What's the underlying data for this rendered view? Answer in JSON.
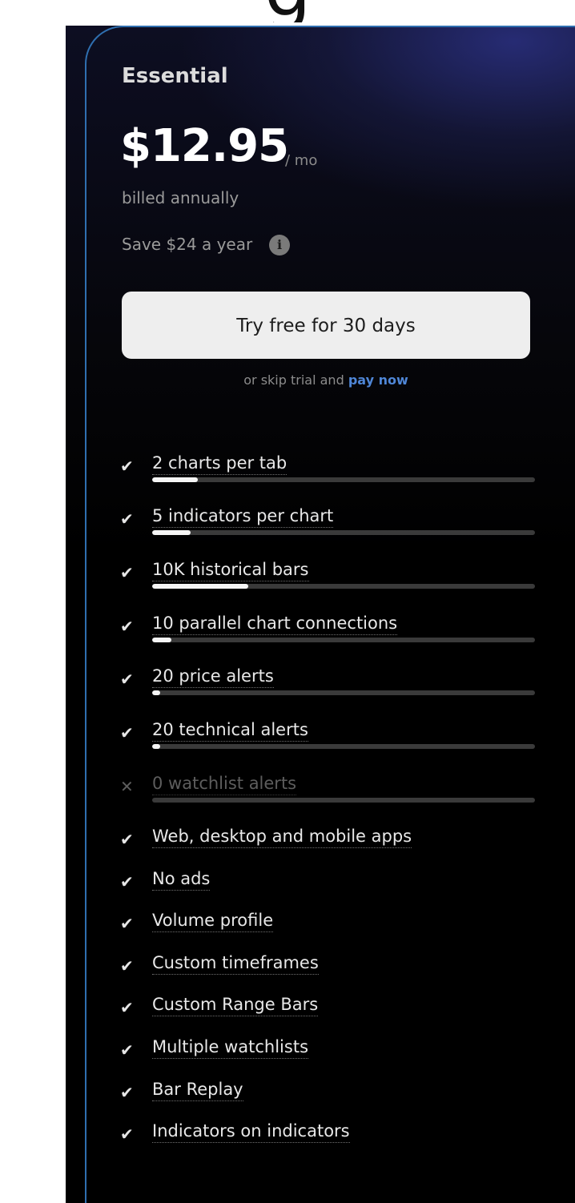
{
  "header_fragment": "g",
  "plan": {
    "name": "Essential",
    "price": "$12.95",
    "period": "/ mo",
    "billing": "billed annually",
    "savings": "Save $24 a year",
    "info_icon": "info-icon",
    "cta_label": "Try free for 30 days",
    "skip_text": "or skip trial and",
    "skip_link": "pay now"
  },
  "colors": {
    "accent_link": "#4f86d6",
    "card_border": "#2f6fb0",
    "bar_fill": "#f5f5f5",
    "bar_track": "#3a3a3a"
  },
  "features": [
    {
      "label": "2 charts per tab",
      "included": true,
      "level": 0.12
    },
    {
      "label": "5 indicators per chart",
      "included": true,
      "level": 0.1
    },
    {
      "label": "10K historical bars",
      "included": true,
      "level": 0.25
    },
    {
      "label": "10 parallel chart connections",
      "included": true,
      "level": 0.05
    },
    {
      "label": "20 price alerts",
      "included": true,
      "level": 0.02
    },
    {
      "label": "20 technical alerts",
      "included": true,
      "level": 0.02
    },
    {
      "label": "0 watchlist alerts",
      "included": false,
      "level": 0
    },
    {
      "label": "Web, desktop and mobile apps",
      "included": true
    },
    {
      "label": "No ads",
      "included": true
    },
    {
      "label": "Volume profile",
      "included": true
    },
    {
      "label": "Custom timeframes",
      "included": true
    },
    {
      "label": "Custom Range Bars",
      "included": true
    },
    {
      "label": "Multiple watchlists",
      "included": true
    },
    {
      "label": "Bar Replay",
      "included": true
    },
    {
      "label": "Indicators on indicators",
      "included": true
    }
  ]
}
